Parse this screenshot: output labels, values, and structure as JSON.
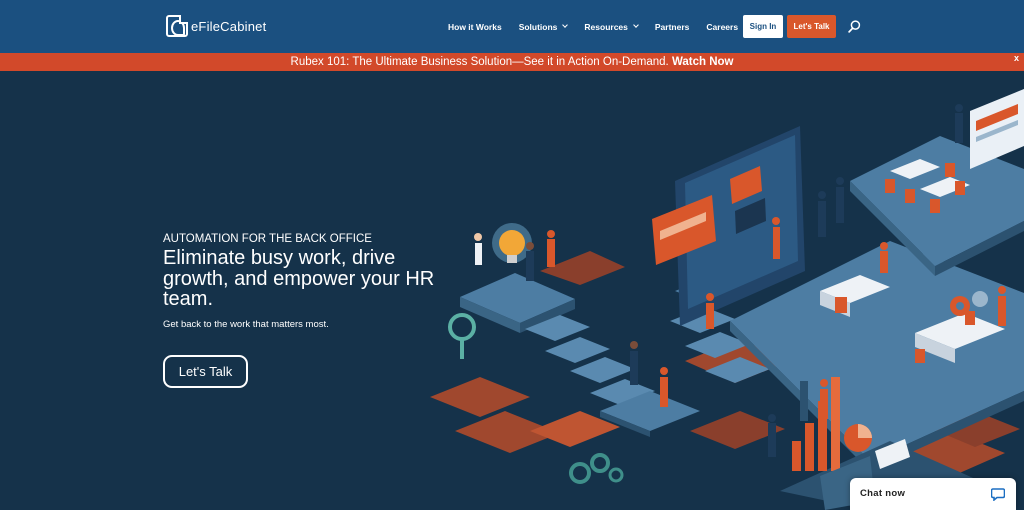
{
  "nav": {
    "logo_text": "eFileCabinet",
    "links": [
      {
        "label": "How it Works",
        "dropdown": false
      },
      {
        "label": "Solutions",
        "dropdown": true
      },
      {
        "label": "Resources",
        "dropdown": true
      },
      {
        "label": "Partners",
        "dropdown": false
      },
      {
        "label": "Careers",
        "dropdown": false
      }
    ],
    "signin_label": "Sign In",
    "talk_label": "Let's Talk",
    "search_icon": "search-icon"
  },
  "banner": {
    "text": "Rubex 101: The Ultimate Business Solution—See it in Action On-Demand.",
    "link_label": "Watch Now",
    "close_label": "x"
  },
  "hero": {
    "eyebrow": "AUTOMATION FOR THE BACK OFFICE",
    "headline": "Eliminate busy work, drive growth, and empower your HR team.",
    "subtext": "Get back to the work that matters most.",
    "cta_label": "Let's Talk"
  },
  "chat": {
    "label": "Chat now",
    "icon": "chat-bubble-icon"
  },
  "colors": {
    "nav_bg": "#1b5080",
    "banner_bg": "#d2492a",
    "hero_bg": "#15324a",
    "accent_orange": "#d9572b"
  }
}
